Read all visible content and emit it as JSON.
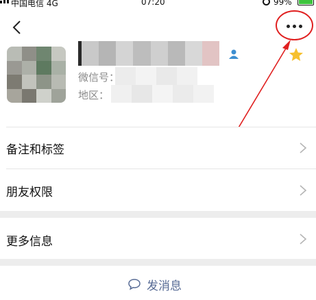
{
  "status_bar": {
    "carrier": "中国电信",
    "network": "4G",
    "time": "07:20",
    "battery_percent": "99%"
  },
  "profile": {
    "wechat_id_label": "微信号：",
    "region_label": "地区："
  },
  "menu": {
    "items": [
      {
        "label": "备注和标签"
      },
      {
        "label": "朋友权限"
      },
      {
        "label": "更多信息"
      }
    ]
  },
  "actions": {
    "send_message_label": "发消息"
  },
  "colors": {
    "annotation": "#e02020",
    "link": "#576b95",
    "star": "#f6c02e",
    "gender": "#3d8fd1"
  }
}
